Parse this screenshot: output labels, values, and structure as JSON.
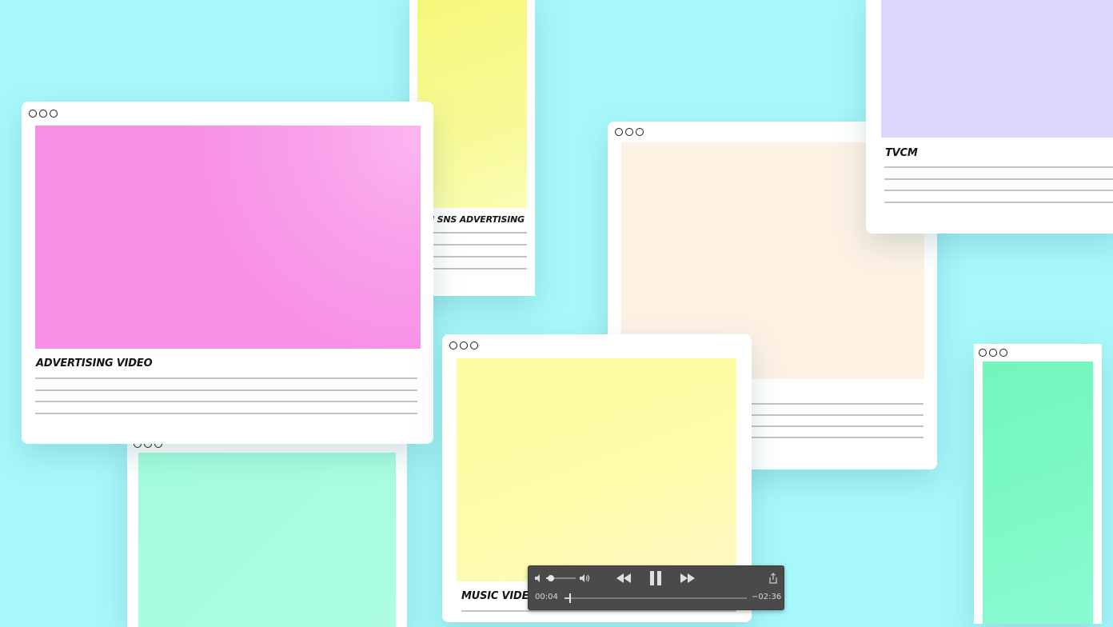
{
  "cards": {
    "sns": {
      "label": "N SNS ADVERTISING",
      "media_color": "#f8fa8e"
    },
    "advertising_video": {
      "label": "ADVERTISING VIDEO",
      "media_color": "#f78fe6"
    },
    "peach": {
      "media_color": "#fdf1e4"
    },
    "tvcm": {
      "label": "TVCM",
      "media_color": "#ddd6fd"
    },
    "green_left": {
      "media_color": "#a8fde0"
    },
    "music_video": {
      "label": "MUSIC VIDEO",
      "media_color": "#fdfca8"
    },
    "green_right": {
      "media_color": "#7cf9c6"
    }
  },
  "player": {
    "elapsed": "00:04",
    "remaining": "−02:36",
    "volume_level": 0.12,
    "progress": 0.025,
    "icons": [
      "volume-low-icon",
      "volume-high-icon",
      "rewind-icon",
      "pause-icon",
      "fast-forward-icon",
      "share-icon"
    ]
  },
  "colors": {
    "background": "#a7f8fb",
    "card": "#ffffff",
    "rule_line": "#c4c4c4",
    "player_bg": "#4a4a4a"
  }
}
